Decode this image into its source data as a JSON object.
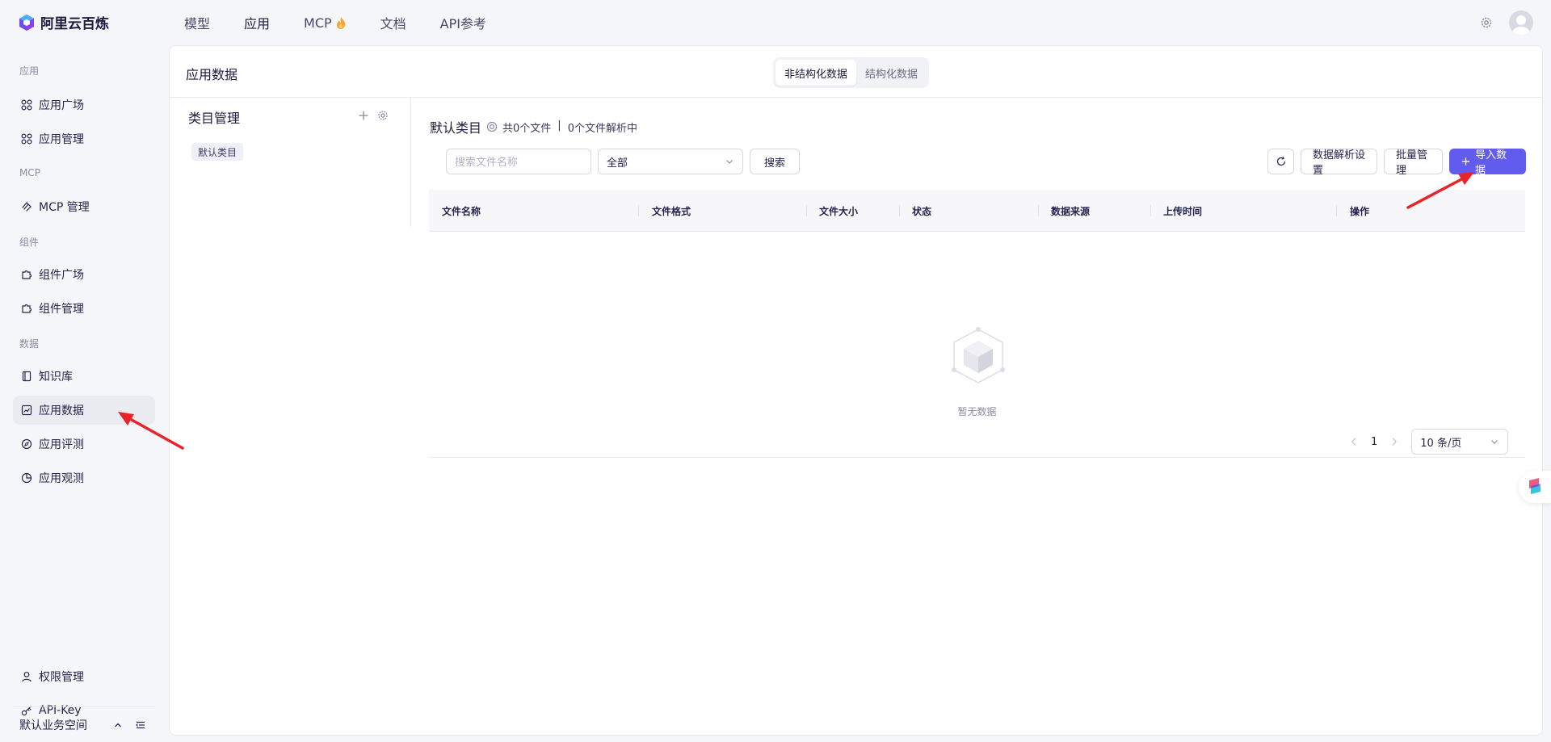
{
  "brand": {
    "name": "阿里云百炼"
  },
  "nav": {
    "items": [
      {
        "label": "模型"
      },
      {
        "label": "应用"
      },
      {
        "label": "MCP"
      },
      {
        "label": "文档"
      },
      {
        "label": "API参考"
      }
    ],
    "active": "应用"
  },
  "sidebar": {
    "groups": {
      "app": "应用",
      "mcp": "MCP",
      "component": "组件",
      "data": "数据"
    },
    "items": {
      "app_plaza": "应用广场",
      "app_manage": "应用管理",
      "mcp_manage": "MCP 管理",
      "comp_plaza": "组件广场",
      "comp_manage": "组件管理",
      "knowledge": "知识库",
      "app_data": "应用数据",
      "app_eval": "应用评测",
      "app_observe": "应用观测",
      "permissions": "权限管理",
      "api_key": "API-Key"
    },
    "workspace": "默认业务空间",
    "active": "应用数据"
  },
  "main": {
    "title": "应用数据",
    "tabs": [
      {
        "label": "非结构化数据",
        "active": true
      },
      {
        "label": "结构化数据",
        "active": false
      }
    ]
  },
  "category": {
    "title": "类目管理",
    "chip": "默认类目"
  },
  "content": {
    "title": "默认类目",
    "file_count": "共0个文件",
    "divider": "|",
    "parsing": "0个文件解析中"
  },
  "toolbar": {
    "search_placeholder": "搜索文件名称",
    "select_value": "全部",
    "search_btn": "搜索",
    "parse_settings_btn": "数据解析设置",
    "batch_btn": "批量管理",
    "import_btn": "导入数据"
  },
  "table": {
    "columns": [
      "文件名称",
      "文件格式",
      "文件大小",
      "状态",
      "数据来源",
      "上传时间",
      "操作"
    ],
    "empty_text": "暂无数据"
  },
  "pagination": {
    "current_page": "1",
    "page_size": "10 条/页"
  },
  "colors": {
    "primary": "#615ced",
    "annotation_arrow": "#e8232a"
  }
}
